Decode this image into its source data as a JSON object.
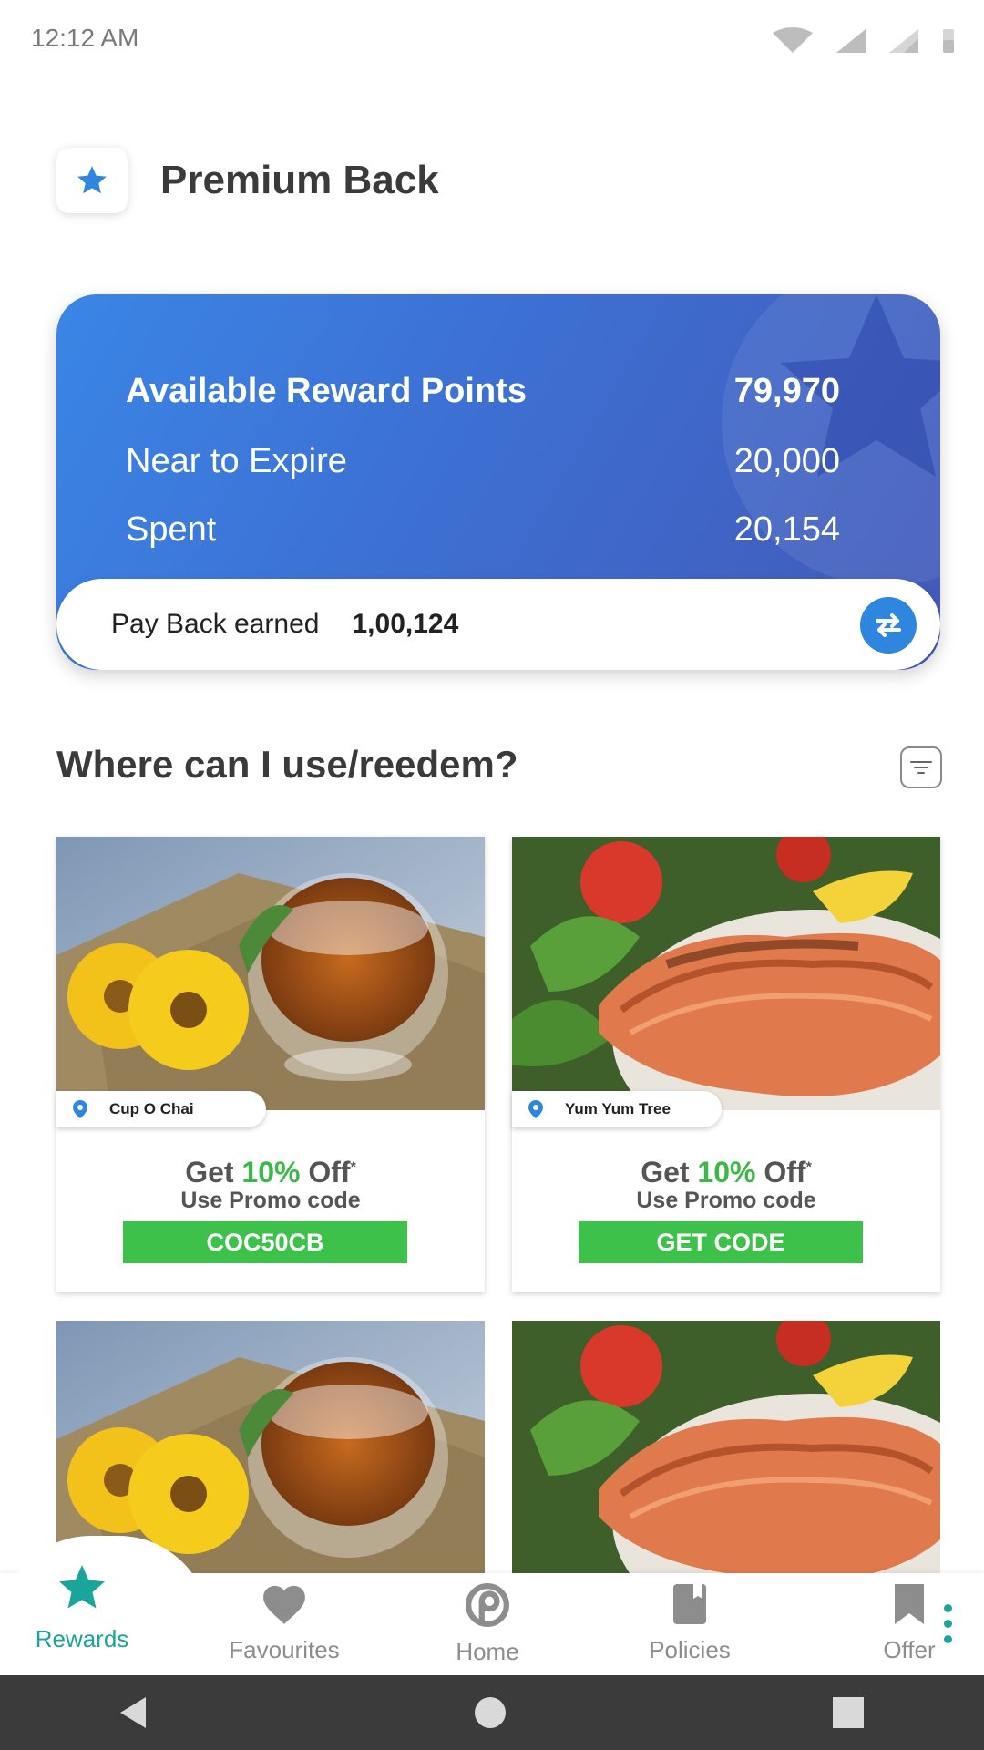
{
  "status_bar": {
    "time": "12:12 AM"
  },
  "header": {
    "title": "Premium Back"
  },
  "points_card": {
    "rows": [
      {
        "label": "Available Reward Points",
        "value": "79,970"
      },
      {
        "label": "Near to Expire",
        "value": "20,000"
      },
      {
        "label": "Spent",
        "value": "20,154"
      }
    ],
    "payback_label": "Pay Back earned",
    "payback_value": "1,00,124"
  },
  "section": {
    "title": "Where can I use/reedem?"
  },
  "offers": [
    {
      "location": "Cup O Chai",
      "get": "Get",
      "percent": "10%",
      "off": "Off",
      "star": "*",
      "promo_label": "Use Promo code",
      "code": "COC50CB",
      "image": "tea-flowers-image"
    },
    {
      "location": "Yum Yum Tree",
      "get": "Get",
      "percent": "10%",
      "off": "Off",
      "star": "*",
      "promo_label": "Use Promo code",
      "code": "GET CODE",
      "image": "salmon-salad-image"
    },
    {
      "image": "tea-flowers-image"
    },
    {
      "image": "salmon-salad-image"
    }
  ],
  "bottom_nav": {
    "items": [
      {
        "label": "Rewards",
        "icon": "star-icon",
        "active": true
      },
      {
        "label": "Favourites",
        "icon": "heart-icon"
      },
      {
        "label": "Home",
        "icon": "home-icon"
      },
      {
        "label": "Policies",
        "icon": "policy-book-icon"
      },
      {
        "label": "Offer",
        "icon": "bookmark-icon"
      }
    ]
  },
  "colors": {
    "accent": "#1aa59b",
    "card_blue": "#3d6fd2",
    "promo_green": "#3ec14a",
    "percent_green": "#3cb84a"
  }
}
